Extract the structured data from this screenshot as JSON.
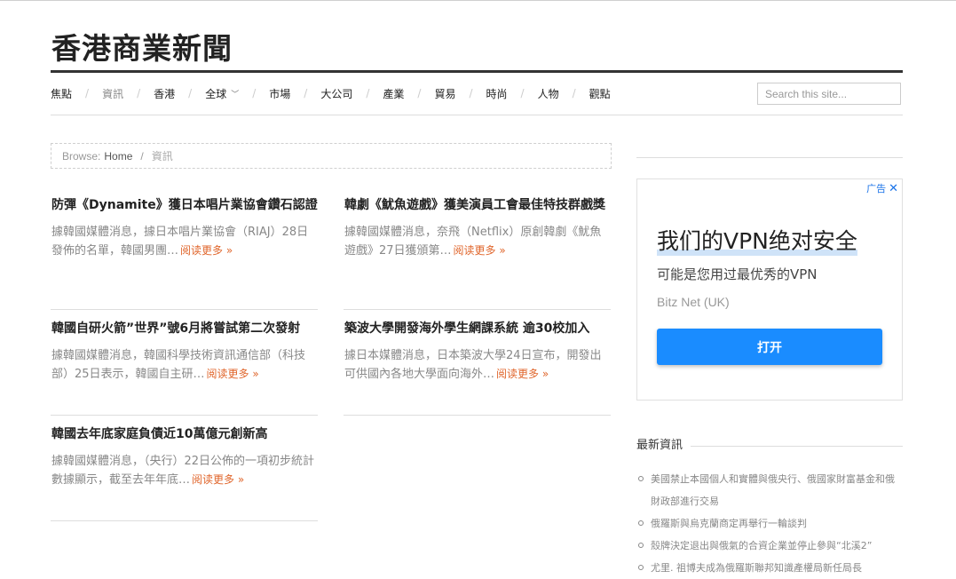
{
  "site": {
    "title": "香港商業新聞"
  },
  "nav": {
    "items": [
      {
        "label": "焦點",
        "active": false
      },
      {
        "label": "資訊",
        "active": true
      },
      {
        "label": "香港",
        "active": false
      },
      {
        "label": "全球",
        "active": false,
        "dropdown": true
      },
      {
        "label": "市場",
        "active": false
      },
      {
        "label": "大公司",
        "active": false
      },
      {
        "label": "產業",
        "active": false
      },
      {
        "label": "貿易",
        "active": false
      },
      {
        "label": "時尚",
        "active": false
      },
      {
        "label": "人物",
        "active": false
      },
      {
        "label": "觀點",
        "active": false
      }
    ],
    "separator": "/",
    "search_placeholder": "Search this site..."
  },
  "breadcrumb": {
    "label": "Browse:",
    "home": "Home",
    "separator": "/",
    "current": "資訊"
  },
  "posts": [
    {
      "title": "防彈《Dynamite》獲日本唱片業協會鑽石認證",
      "excerpt": "據韓國媒體消息，據日本唱片業協會（RIAJ）28日發佈的名單，韓國男團…",
      "read_more": "阅读更多 »"
    },
    {
      "title": "韓劇《魷魚遊戲》獲美演員工會最佳特技群戲獎",
      "excerpt": "據韓國媒體消息，奈飛（Netflix）原創韓劇《魷魚遊戲》27日獲頒第…",
      "read_more": "阅读更多 »"
    },
    {
      "title": "韓國自研火箭”世界”號6月將嘗試第二次發射",
      "excerpt": "據韓國媒體消息，韓國科學技術資訊通信部（科技部）25日表示，韓國自主研…",
      "read_more": "阅读更多 »"
    },
    {
      "title": "築波大學開發海外學生網課系統 逾30校加入",
      "excerpt": "據日本媒體消息，日本築波大學24日宣布，開發出可供國內各地大學面向海外…",
      "read_more": "阅读更多 »"
    },
    {
      "title": "韓國去年底家庭負債近10萬億元創新高",
      "excerpt": "據韓國媒體消息，（央行）22日公佈的一項初步統計數據顯示，截至去年年底…",
      "read_more": "阅读更多 »"
    }
  ],
  "ad": {
    "badge": "广告",
    "close": "✕",
    "headline": "我们的VPN绝对安全",
    "sub": "可能是您用过最优秀的VPN",
    "brand": "Bitz Net (UK)",
    "button": "打开",
    "colors": {
      "button": "#1a8cff",
      "badge": "#1a73e8"
    }
  },
  "sidebar": {
    "latest_title": "最新資訊",
    "latest": [
      "美國禁止本國個人和實體與俄央行、俄國家財富基金和俄財政部進行交易",
      "俄羅斯與烏克蘭商定再舉行一輪談判",
      "殼牌決定退出與俄氣的合資企業並停止參與“北溪2”",
      "尤里. 祖博夫成為俄羅斯聯邦知識產權局新任局長"
    ]
  },
  "colors": {
    "read_more": "#e0662c",
    "title_rule": "#333333"
  }
}
